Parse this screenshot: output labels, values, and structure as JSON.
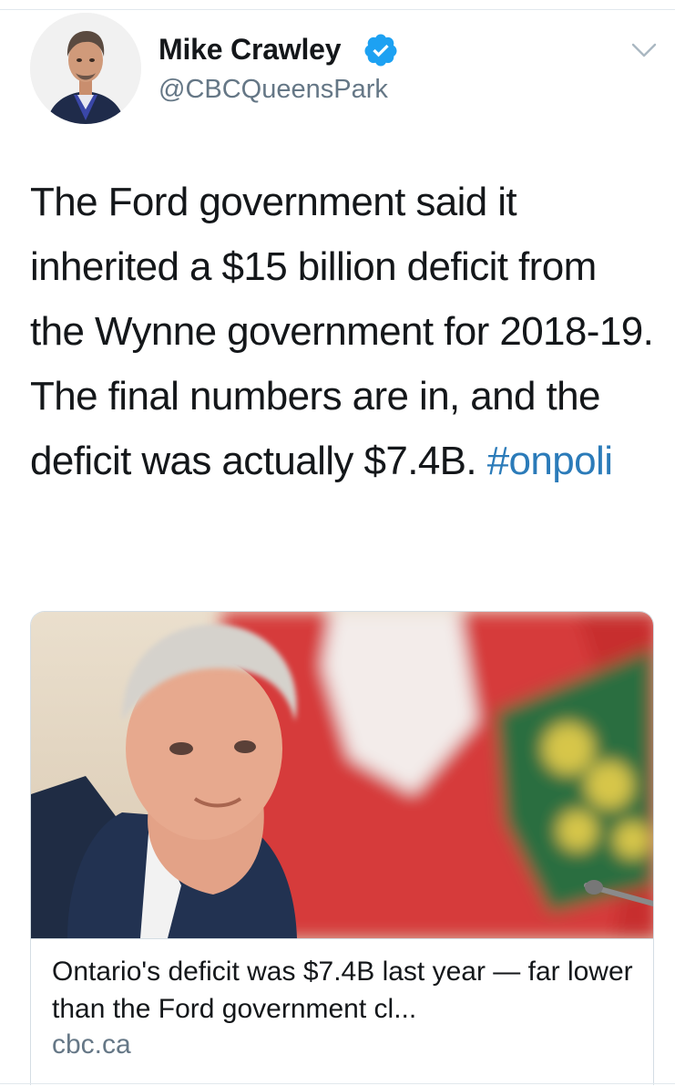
{
  "author": {
    "name": "Mike Crawley",
    "handle": "@CBCQueensPark",
    "verified": true
  },
  "tweet": {
    "text": "The Ford government said it inherited a $15 billion deficit from the Wynne government for 2018-19. The final numbers are in, and the deficit was actually $7.4B.",
    "hashtag": "#onpoli"
  },
  "card": {
    "headline": "Ontario's deficit was $7.4B last year — far lower than the Ford government cl...",
    "domain": "cbc.ca"
  },
  "colors": {
    "link": "#2b7bb9",
    "verified": "#1da1f2",
    "secondary_text": "#657786"
  },
  "icons": [
    "verified-badge-icon",
    "chevron-down-icon"
  ]
}
